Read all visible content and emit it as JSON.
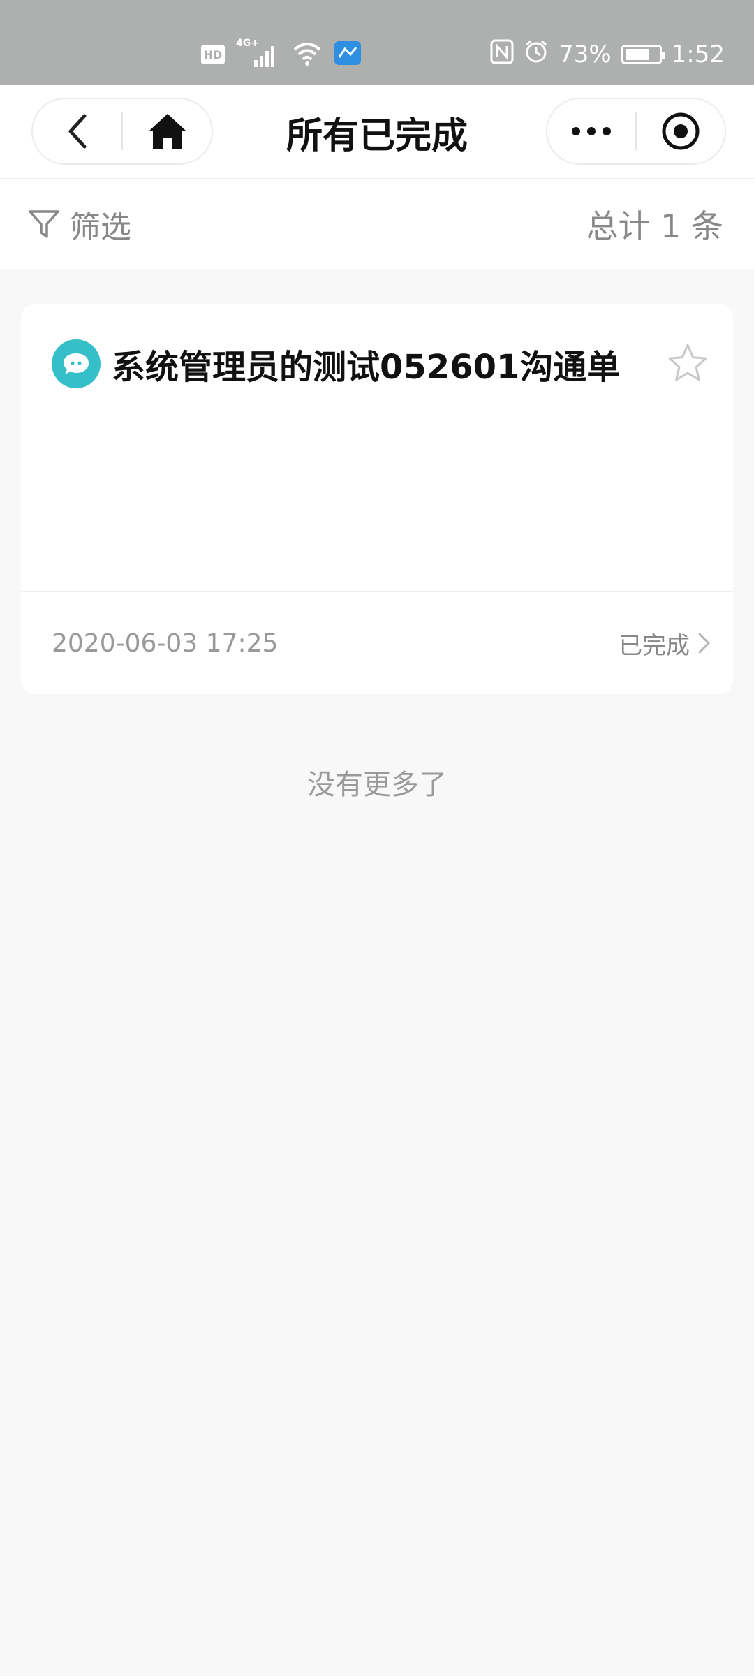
{
  "status_bar": {
    "hd": "HD",
    "network": "4G+",
    "battery": "73%",
    "battery_level": 0.73,
    "time": "1:52"
  },
  "nav": {
    "title": "所有已完成",
    "icons": [
      "back-icon",
      "home-icon",
      "more-icon",
      "record-icon"
    ]
  },
  "filter": {
    "label": "筛选",
    "total": "总计 1 条"
  },
  "records": [
    {
      "title": "系统管理员的测试052601沟通单",
      "date": "2020-06-03 17:25",
      "status": "已完成",
      "icon": "chat-icon",
      "starred": false
    }
  ],
  "footer": {
    "no_more": "没有更多了"
  },
  "colors": {
    "status_bar_bg": "#aeb0af",
    "accent": "#35bfc9",
    "background": "#f8f8f8"
  }
}
